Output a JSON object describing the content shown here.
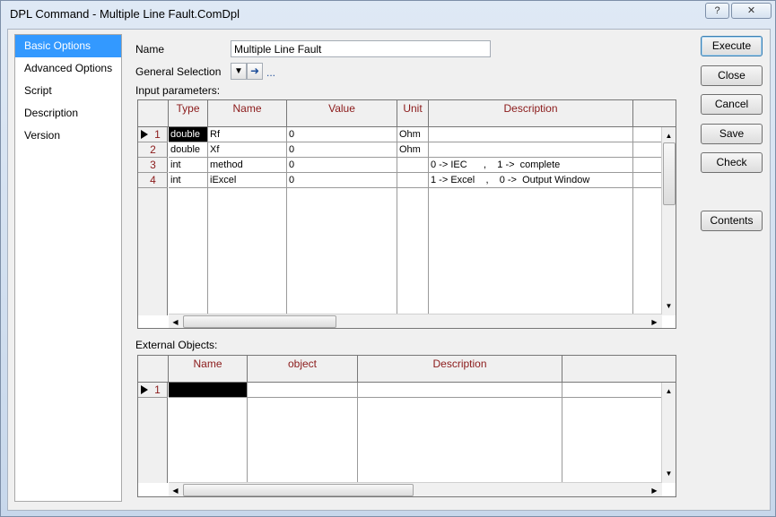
{
  "window": {
    "title": "DPL Command - Multiple Line Fault.ComDpl",
    "help_label": "?",
    "close_label": "✕"
  },
  "nav": {
    "items": [
      {
        "label": "Basic Options"
      },
      {
        "label": "Advanced Options"
      },
      {
        "label": "Script"
      },
      {
        "label": "Description"
      },
      {
        "label": "Version"
      }
    ]
  },
  "form": {
    "name_label": "Name",
    "name_value": "Multiple Line Fault",
    "general_selection_label": "General Selection",
    "ellipsis": "...",
    "input_params_label": "Input parameters:",
    "external_objects_label": "External Objects:"
  },
  "input_table": {
    "headers": [
      "Type",
      "Name",
      "Value",
      "Unit",
      "Description"
    ],
    "rows": [
      {
        "num": "1",
        "type": "double",
        "name": "Rf",
        "value": "0",
        "unit": "Ohm",
        "description": ""
      },
      {
        "num": "2",
        "type": "double",
        "name": "Xf",
        "value": "0",
        "unit": "Ohm",
        "description": ""
      },
      {
        "num": "3",
        "type": "int",
        "name": "method",
        "value": "0",
        "unit": "",
        "description": "0 -> IEC      ,    1 ->  complete"
      },
      {
        "num": "4",
        "type": "int",
        "name": "iExcel",
        "value": "0",
        "unit": "",
        "description": "1 -> Excel    ,    0 ->  Output Window"
      }
    ]
  },
  "external_table": {
    "headers": [
      "Name",
      "object",
      "Description"
    ],
    "rows": [
      {
        "num": "1"
      }
    ]
  },
  "buttons": {
    "execute": "Execute",
    "close": "Close",
    "cancel": "Cancel",
    "save": "Save",
    "check": "Check",
    "contents": "Contents"
  },
  "colors": {
    "selected_nav": "#3399ff",
    "header_text": "#8b1a1a"
  }
}
